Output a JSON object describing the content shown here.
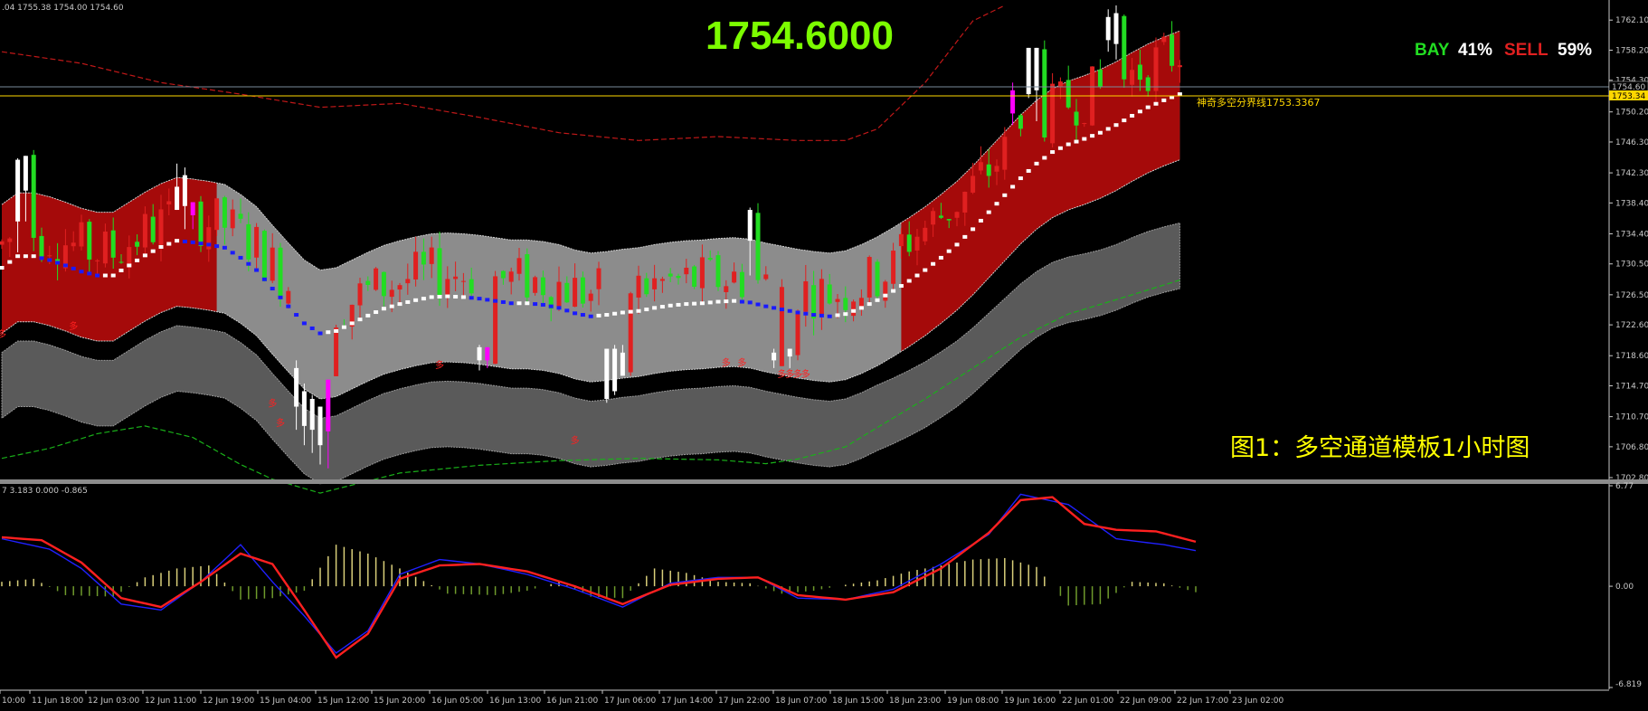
{
  "header": {
    "main_info": ".04 1755.38 1754.00 1754.60",
    "sub_info": "7 3.183 0.000 -0.865"
  },
  "price_display": "1754.6000",
  "sentiment": {
    "buy_label": "BAY",
    "buy_pct": "41%",
    "sell_label": "SELL",
    "sell_pct": "59%",
    "buy_color": "#22dd22",
    "sell_color": "#e02020",
    "pct_color": "#ffffff"
  },
  "caption": "图1：多空通道模板1小时图",
  "line_label": "神奇多空分界线1753.3367",
  "price_tags": {
    "current": "1754.60",
    "line": "1753.34"
  },
  "signal_glyph": "多",
  "colors": {
    "bull": "#e02020",
    "bear": "#22dd22",
    "bull_zone": "#a50a0a",
    "range_zone": "#8c8c8c",
    "midline_up": "#ffffff",
    "midline_down": "#1a1aff",
    "macd": "#2020ff",
    "signal": "#ff2020"
  },
  "chart_data": [
    {
      "type": "line",
      "series_kind": "candlestick with channel bands",
      "ylim": [
        1702.8,
        1764.0
      ],
      "y_ticks": [
        "1762.10",
        "1758.20",
        "1754.30",
        "1750.20",
        "1746.30",
        "1742.30",
        "1738.40",
        "1734.40",
        "1730.50",
        "1726.50",
        "1722.60",
        "1718.60",
        "1714.70",
        "1710.70",
        "1706.80",
        "1702.80"
      ],
      "x_ticks": [
        "10:00",
        "11 Jun 18:00",
        "12 Jun 03:00",
        "12 Jun 11:00",
        "12 Jun 19:00",
        "15 Jun 04:00",
        "15 Jun 12:00",
        "15 Jun 20:00",
        "16 Jun 05:00",
        "16 Jun 13:00",
        "16 Jun 21:00",
        "17 Jun 06:00",
        "17 Jun 14:00",
        "17 Jun 22:00",
        "18 Jun 07:00",
        "18 Jun 15:00",
        "18 Jun 23:00",
        "19 Jun 08:00",
        "19 Jun 16:00",
        "22 Jun 01:00",
        "22 Jun 09:00",
        "22 Jun 17:00",
        "23 Jun 02:00"
      ],
      "midline": [
        [
          0,
          1730
        ],
        [
          2,
          1731.5
        ],
        [
          4,
          1731.5
        ],
        [
          6,
          1731
        ],
        [
          8,
          1730.3
        ],
        [
          10,
          1729.5
        ],
        [
          12,
          1729
        ],
        [
          14,
          1729
        ],
        [
          16,
          1730.3
        ],
        [
          18,
          1731.6
        ],
        [
          20,
          1732.7
        ],
        [
          22,
          1733.5
        ],
        [
          24,
          1733.3
        ],
        [
          26,
          1733
        ],
        [
          28,
          1732.6
        ],
        [
          30,
          1731.3
        ],
        [
          32,
          1729.7
        ],
        [
          34,
          1727.3
        ],
        [
          36,
          1725
        ],
        [
          38,
          1722.8
        ],
        [
          40,
          1721.5
        ],
        [
          42,
          1721.8
        ],
        [
          44,
          1722.8
        ],
        [
          46,
          1723.8
        ],
        [
          48,
          1724.7
        ],
        [
          50,
          1725.3
        ],
        [
          52,
          1725.8
        ],
        [
          54,
          1726.2
        ],
        [
          56,
          1726.3
        ],
        [
          58,
          1726.2
        ],
        [
          60,
          1726
        ],
        [
          62,
          1725.7
        ],
        [
          64,
          1725.4
        ],
        [
          66,
          1725.4
        ],
        [
          68,
          1725.2
        ],
        [
          70,
          1724.8
        ],
        [
          72,
          1724.1
        ],
        [
          74,
          1723.7
        ],
        [
          76,
          1723.9
        ],
        [
          78,
          1724.2
        ],
        [
          80,
          1724.4
        ],
        [
          82,
          1724.8
        ],
        [
          84,
          1725.1
        ],
        [
          86,
          1725.3
        ],
        [
          88,
          1725.4
        ],
        [
          90,
          1725.6
        ],
        [
          92,
          1725.7
        ],
        [
          94,
          1725.5
        ],
        [
          96,
          1725
        ],
        [
          98,
          1724.6
        ],
        [
          100,
          1724.2
        ],
        [
          102,
          1723.9
        ],
        [
          104,
          1723.7
        ],
        [
          106,
          1724
        ],
        [
          108,
          1724.8
        ],
        [
          110,
          1725.8
        ],
        [
          112,
          1727
        ],
        [
          114,
          1728.3
        ],
        [
          116,
          1729.7
        ],
        [
          118,
          1731.3
        ],
        [
          120,
          1733
        ],
        [
          122,
          1735
        ],
        [
          124,
          1737.2
        ],
        [
          126,
          1739.4
        ],
        [
          128,
          1741.6
        ],
        [
          130,
          1743.5
        ],
        [
          132,
          1745
        ],
        [
          134,
          1746
        ],
        [
          136,
          1746.7
        ],
        [
          138,
          1747.5
        ],
        [
          140,
          1748.5
        ],
        [
          142,
          1749.7
        ],
        [
          144,
          1750.8
        ],
        [
          146,
          1751.7
        ],
        [
          148,
          1752.5
        ]
      ],
      "upper_band_offset": 8.2,
      "lower_band_offset": 8.5,
      "outer_upper": [
        [
          0,
          1758
        ],
        [
          10,
          1756.5
        ],
        [
          20,
          1754
        ],
        [
          30,
          1752.5
        ],
        [
          40,
          1750.8
        ],
        [
          50,
          1751.3
        ],
        [
          60,
          1749.5
        ],
        [
          70,
          1747.5
        ],
        [
          80,
          1746.5
        ],
        [
          90,
          1747
        ],
        [
          100,
          1746.5
        ],
        [
          106,
          1746.5
        ],
        [
          110,
          1748
        ],
        [
          116,
          1754
        ],
        [
          122,
          1762
        ],
        [
          126,
          1764
        ]
      ],
      "outer_lower": [
        [
          0,
          1705.3
        ],
        [
          6,
          1706.6
        ],
        [
          12,
          1708.5
        ],
        [
          18,
          1709.5
        ],
        [
          24,
          1708
        ],
        [
          30,
          1704.5
        ],
        [
          34,
          1702.6
        ],
        [
          40,
          1700.8
        ],
        [
          50,
          1703.4
        ],
        [
          60,
          1704.4
        ],
        [
          70,
          1705
        ],
        [
          80,
          1705.3
        ],
        [
          90,
          1705.1
        ],
        [
          96,
          1704.6
        ],
        [
          100,
          1705.2
        ],
        [
          106,
          1706.8
        ],
        [
          110,
          1709.3
        ],
        [
          116,
          1713
        ],
        [
          122,
          1717
        ],
        [
          128,
          1721
        ],
        [
          134,
          1724
        ],
        [
          142,
          1726.5
        ],
        [
          148,
          1728.4
        ]
      ],
      "bull_zones": [
        [
          0,
          27
        ],
        [
          113,
          149
        ]
      ],
      "spike_candles": [
        {
          "i": 2,
          "open": 1736,
          "close": 1744,
          "high": 1744.2,
          "low": 1732,
          "color": "white"
        },
        {
          "i": 3,
          "open": 1740,
          "close": 1744.5,
          "high": 1744.5,
          "low": 1736,
          "color": "white"
        },
        {
          "i": 22,
          "open": 1737.5,
          "close": 1740.5,
          "high": 1743.5,
          "low": 1737.5,
          "color": "white"
        },
        {
          "i": 23,
          "open": 1738,
          "close": 1742,
          "high": 1743,
          "low": 1735,
          "color": "white"
        },
        {
          "i": 24,
          "open": 1736.8,
          "close": 1738.5,
          "high": 1738.5,
          "low": 1735,
          "color": "#ff00ff"
        },
        {
          "i": 37,
          "open": 1717,
          "close": 1712,
          "high": 1718,
          "low": 1709,
          "color": "white"
        },
        {
          "i": 38,
          "open": 1714,
          "close": 1709.5,
          "high": 1715,
          "low": 1707,
          "color": "white"
        },
        {
          "i": 39,
          "open": 1713,
          "close": 1709,
          "high": 1713.5,
          "low": 1706,
          "color": "white"
        },
        {
          "i": 40,
          "open": 1712,
          "close": 1707,
          "high": 1712,
          "low": 1704.5,
          "color": "white"
        },
        {
          "i": 41,
          "open": 1708.8,
          "close": 1715.5,
          "high": 1715.5,
          "low": 1704,
          "color": "#ff00ff"
        },
        {
          "i": 60,
          "open": 1719.7,
          "close": 1718,
          "high": 1720,
          "low": 1716.7,
          "color": "white"
        },
        {
          "i": 61,
          "open": 1719.7,
          "close": 1718,
          "high": 1719.7,
          "low": 1717,
          "color": "#ff00ff"
        },
        {
          "i": 76,
          "open": 1719.5,
          "close": 1713,
          "high": 1719.5,
          "low": 1712.5,
          "color": "white"
        },
        {
          "i": 77,
          "open": 1719.5,
          "close": 1714,
          "high": 1720,
          "low": 1713.5,
          "color": "white"
        },
        {
          "i": 78,
          "open": 1719,
          "close": 1716,
          "high": 1720,
          "low": 1716,
          "color": "white"
        },
        {
          "i": 94,
          "open": 1733.5,
          "close": 1737.5,
          "high": 1737.8,
          "low": 1729,
          "color": "white"
        },
        {
          "i": 97,
          "open": 1719,
          "close": 1718,
          "high": 1719.5,
          "low": 1717,
          "color": "white"
        },
        {
          "i": 99,
          "open": 1719.5,
          "close": 1718.5,
          "high": 1719.5,
          "low": 1717,
          "color": "white"
        },
        {
          "i": 127,
          "open": 1753,
          "close": 1750,
          "high": 1754,
          "low": 1748.5,
          "color": "#ff00ff"
        },
        {
          "i": 129,
          "open": 1752.5,
          "close": 1758.5,
          "high": 1758.5,
          "low": 1752,
          "color": "white"
        },
        {
          "i": 130,
          "open": 1753,
          "close": 1758.5,
          "high": 1758.5,
          "low": 1749,
          "color": "white"
        },
        {
          "i": 139,
          "open": 1759.5,
          "close": 1762.5,
          "high": 1763.5,
          "low": 1758,
          "color": "white"
        },
        {
          "i": 140,
          "open": 1759,
          "close": 1763,
          "high": 1764,
          "low": 1757,
          "color": "white"
        }
      ]
    },
    {
      "type": "line",
      "series_kind": "macd oscillator",
      "ylim": [
        -6.819,
        6.77
      ],
      "y_ticks": [
        "6.77",
        "0.00",
        "-6.819"
      ],
      "macd": [
        [
          0,
          3.2
        ],
        [
          6,
          2.5
        ],
        [
          10,
          1.2
        ],
        [
          15,
          -1.2
        ],
        [
          20,
          -1.6
        ],
        [
          25,
          0.3
        ],
        [
          30,
          2.8
        ],
        [
          34,
          0.3
        ],
        [
          38,
          -2
        ],
        [
          42,
          -4.5
        ],
        [
          46,
          -3
        ],
        [
          50,
          0.8
        ],
        [
          55,
          1.8
        ],
        [
          60,
          1.5
        ],
        [
          66,
          0.8
        ],
        [
          72,
          -0.2
        ],
        [
          78,
          -1.4
        ],
        [
          84,
          0.2
        ],
        [
          90,
          0.6
        ],
        [
          95,
          0.6
        ],
        [
          100,
          -0.8
        ],
        [
          106,
          -0.9
        ],
        [
          112,
          -0.2
        ],
        [
          118,
          1.5
        ],
        [
          124,
          3.5
        ],
        [
          128,
          6.2
        ],
        [
          134,
          5.5
        ],
        [
          140,
          3.2
        ],
        [
          146,
          2.8
        ],
        [
          150,
          2.4
        ]
      ],
      "signal": [
        [
          0,
          3.3
        ],
        [
          5,
          3.1
        ],
        [
          10,
          1.6
        ],
        [
          15,
          -0.8
        ],
        [
          20,
          -1.4
        ],
        [
          25,
          0.3
        ],
        [
          30,
          2.2
        ],
        [
          34,
          1.5
        ],
        [
          38,
          -1.6
        ],
        [
          42,
          -4.8
        ],
        [
          46,
          -3.2
        ],
        [
          50,
          0.5
        ],
        [
          55,
          1.4
        ],
        [
          60,
          1.5
        ],
        [
          66,
          1
        ],
        [
          72,
          0
        ],
        [
          78,
          -1.2
        ],
        [
          84,
          0.1
        ],
        [
          90,
          0.5
        ],
        [
          95,
          0.6
        ],
        [
          100,
          -0.6
        ],
        [
          106,
          -0.9
        ],
        [
          112,
          -0.4
        ],
        [
          118,
          1.2
        ],
        [
          124,
          3.6
        ],
        [
          128,
          5.8
        ],
        [
          132,
          6
        ],
        [
          136,
          4.2
        ],
        [
          140,
          3.8
        ],
        [
          145,
          3.7
        ],
        [
          150,
          3
        ]
      ],
      "histogram": [
        [
          0,
          0.3
        ],
        [
          4,
          0.5
        ],
        [
          8,
          -0.6
        ],
        [
          14,
          -0.7
        ],
        [
          18,
          0.6
        ],
        [
          22,
          1.2
        ],
        [
          26,
          1.4
        ],
        [
          30,
          -0.9
        ],
        [
          34,
          -0.8
        ],
        [
          38,
          -0.3
        ],
        [
          42,
          2.8
        ],
        [
          46,
          2.2
        ],
        [
          50,
          1.2
        ],
        [
          56,
          -0.5
        ],
        [
          62,
          -0.6
        ],
        [
          66,
          -0.3
        ],
        [
          70,
          0.3
        ],
        [
          74,
          -0.7
        ],
        [
          78,
          -0.8
        ],
        [
          82,
          1.2
        ],
        [
          86,
          0.9
        ],
        [
          90,
          0.3
        ],
        [
          94,
          0.2
        ],
        [
          98,
          -0.5
        ],
        [
          102,
          -0.3
        ],
        [
          106,
          0.1
        ],
        [
          110,
          0.4
        ],
        [
          114,
          1
        ],
        [
          118,
          1.4
        ],
        [
          122,
          1.8
        ],
        [
          126,
          1.9
        ],
        [
          130,
          1.3
        ],
        [
          134,
          -1.3
        ],
        [
          138,
          -1.2
        ],
        [
          142,
          0.3
        ],
        [
          146,
          0.2
        ],
        [
          150,
          -0.4
        ]
      ]
    }
  ]
}
